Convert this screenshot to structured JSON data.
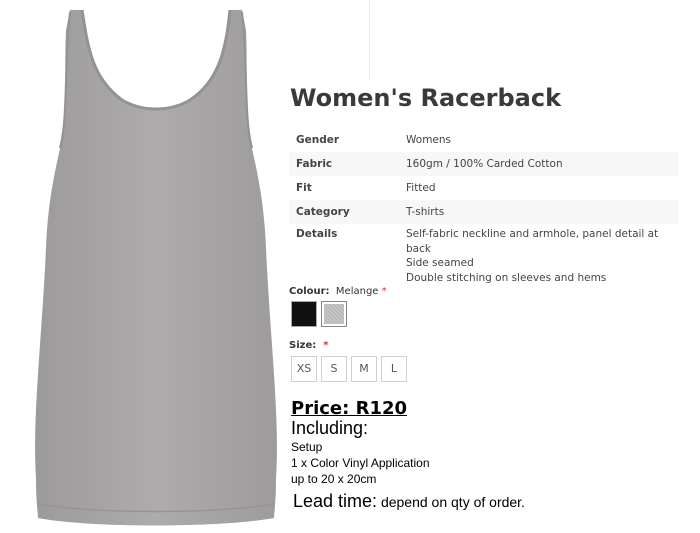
{
  "product": {
    "title": "Women's Racerback",
    "specs": [
      {
        "label": "Gender",
        "value": "Womens"
      },
      {
        "label": "Fabric",
        "value": "160gm / 100% Carded Cotton"
      },
      {
        "label": "Fit",
        "value": "Fitted"
      },
      {
        "label": "Category",
        "value": "T-shirts"
      },
      {
        "label": "Details",
        "lines": [
          "Self-fabric neckline and armhole, panel detail at back",
          "Side seamed",
          "Double stitching on sleeves and hems"
        ]
      }
    ]
  },
  "colour": {
    "label": "Colour:",
    "selected": "Melange",
    "required_mark": "*",
    "swatches": [
      {
        "name": "Black",
        "color": "#111111"
      },
      {
        "name": "Melange",
        "color": "#c9c7c8"
      }
    ]
  },
  "size": {
    "label": "Size:",
    "required_mark": "*",
    "options": [
      "XS",
      "S",
      "M",
      "L"
    ]
  },
  "price": {
    "label": "Price: R120",
    "including_label": "Including:",
    "items": [
      "Setup",
      "1 x Color Vinyl Application",
      "up to 20 x 20cm"
    ]
  },
  "lead_time": {
    "label": "Lead time:",
    "value": " depend  on qty of order."
  },
  "colors": {
    "shirt": "#a7a5a6",
    "required": "#e0312b"
  }
}
